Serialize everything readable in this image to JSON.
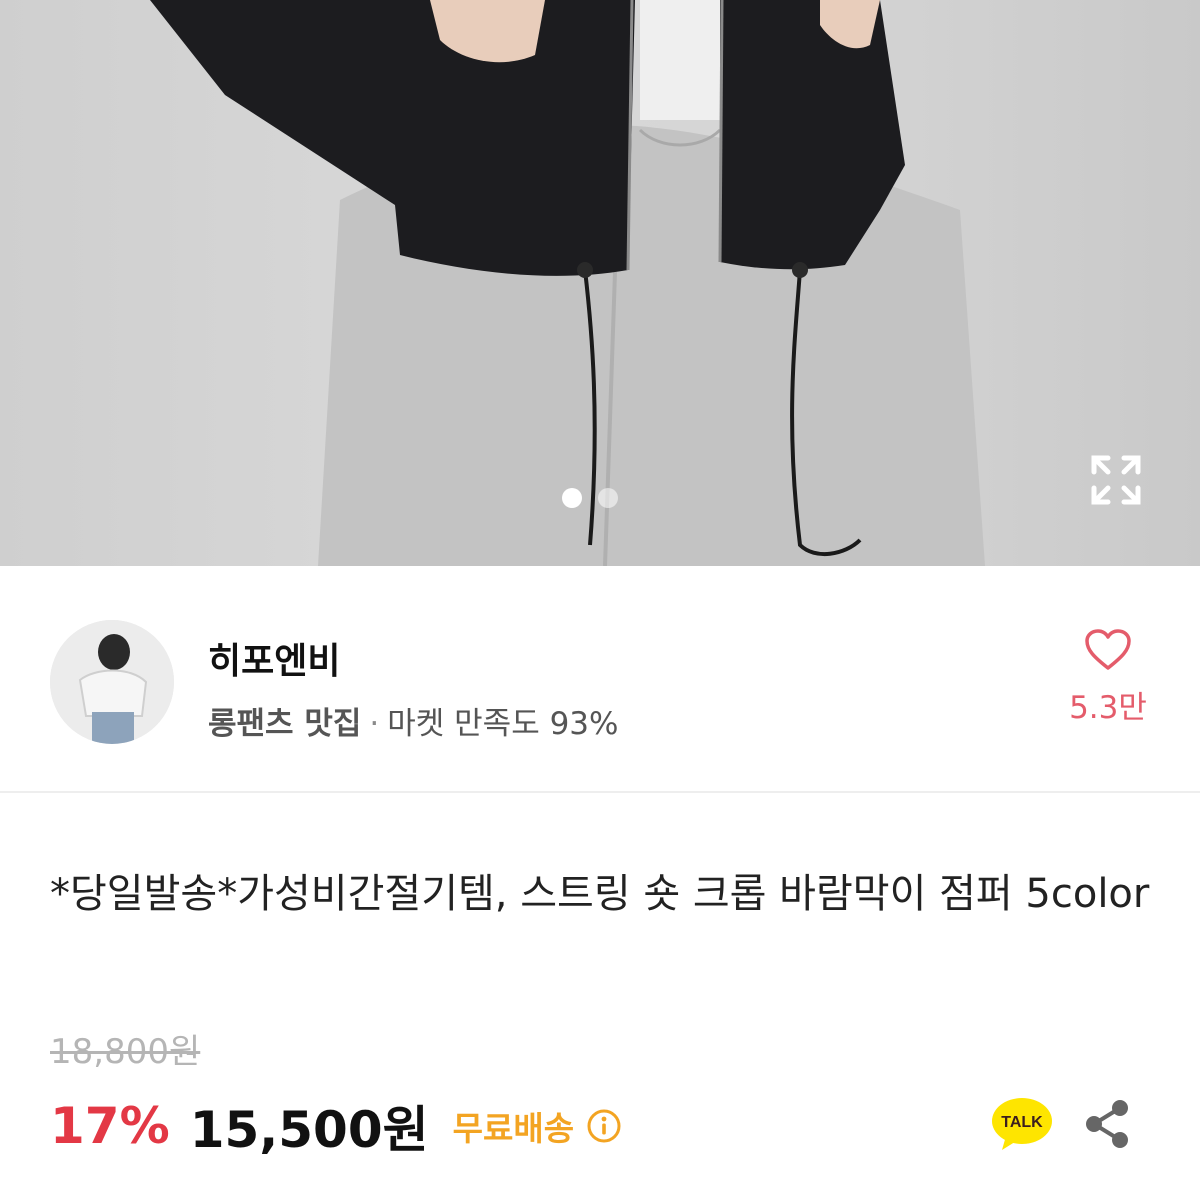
{
  "gallery": {
    "image_alt": "product photo - black cropped windbreaker jacket with grey jogger pants",
    "slide_count": 2,
    "active_slide": 1,
    "expand_icon": "expand-icon"
  },
  "seller": {
    "name": "히포엔비",
    "tag": "롱팬츠 맛집",
    "separator": "·",
    "satisfaction": "마켓 만족도 93%",
    "avatar_icon": "avatar",
    "like_icon": "heart-outline-icon",
    "like_count": "5.3만"
  },
  "product": {
    "title": "*당일발송*가성비간절기템, 스트링 숏 크롭 바람막이 점퍼 5color",
    "original_price": "18,800원",
    "discount": "17%",
    "price": "15,500원",
    "shipping": "무료배송",
    "shipping_info_icon": "info-circle-icon"
  },
  "actions": {
    "talk_label": "TALK",
    "talk_icon": "kakao-talk-icon",
    "share_icon": "share-icon"
  },
  "colors": {
    "accent_red": "#e33845",
    "like_pink": "#e45c6b",
    "shipping_orange": "#f3a422",
    "talk_yellow": "#fee500"
  }
}
